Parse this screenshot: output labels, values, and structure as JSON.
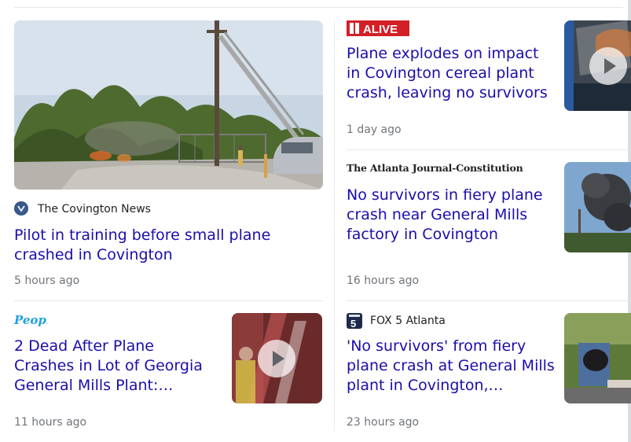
{
  "articles": [
    {
      "source": "The Covington News",
      "headline": "Pilot in training before small plane crashed in Covington",
      "time": "5 hours ago"
    },
    {
      "source": "11Alive",
      "logo_text": "ALIVE",
      "headline": "Plane explodes on impact in Covington cereal plant crash, leaving no survivors",
      "time": "1 day ago",
      "video": true
    },
    {
      "source": "The Atlanta Journal-Constitution",
      "headline": "No survivors in fiery plane crash near General Mills factory in Covington",
      "time": "16 hours ago"
    },
    {
      "source": "People",
      "headline": "2 Dead After Plane Crashes in Lot of Georgia General Mills Plant: 'Horribly Tragic...",
      "time": "11 hours ago",
      "video": true
    },
    {
      "source": "FOX 5 Atlanta",
      "logo_text": "5",
      "headline": "'No survivors' from fiery plane crash at General Mills plant in Covington, officials...",
      "time": "23 hours ago"
    }
  ],
  "colors": {
    "headline": "#1a0dab",
    "time": "#70757a",
    "alive_red": "#d32027",
    "people_blue": "#1ea2dc",
    "fox_navy": "#1d2a4a"
  },
  "icons": [
    "play-icon",
    "covington-news-favicon",
    "fox5-logo",
    "11alive-logo",
    "people-logo",
    "ajc-logo"
  ]
}
